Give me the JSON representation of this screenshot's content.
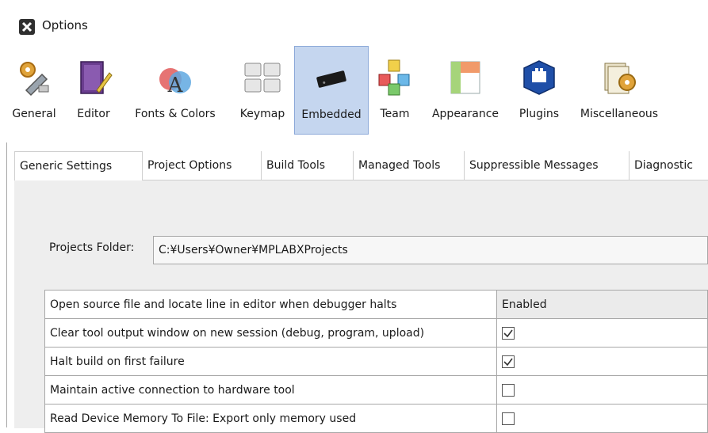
{
  "window": {
    "title": "Options"
  },
  "categories": [
    {
      "label": "General"
    },
    {
      "label": "Editor"
    },
    {
      "label": "Fonts & Colors"
    },
    {
      "label": "Keymap"
    },
    {
      "label": "Embedded",
      "selected": true
    },
    {
      "label": "Team"
    },
    {
      "label": "Appearance"
    },
    {
      "label": "Plugins"
    },
    {
      "label": "Miscellaneous"
    }
  ],
  "tabs": [
    {
      "label": "Generic Settings",
      "active": true
    },
    {
      "label": "Project Options"
    },
    {
      "label": "Build Tools"
    },
    {
      "label": "Managed Tools"
    },
    {
      "label": "Suppressible Messages"
    },
    {
      "label": "Diagnostic"
    }
  ],
  "projects_folder": {
    "label": "Projects Folder:",
    "value": "C:¥Users¥Owner¥MPLABXProjects"
  },
  "settings": [
    {
      "name": "Open source file and locate line in editor when debugger halts",
      "value": "Enabled"
    },
    {
      "name": "Clear tool output window on new session (debug, program, upload)",
      "checked": true
    },
    {
      "name": "Halt build on first failure",
      "checked": true
    },
    {
      "name": "Maintain active connection to hardware tool",
      "checked": false
    },
    {
      "name": "Read Device Memory To File: Export only memory used",
      "checked": false
    }
  ],
  "colors": {
    "selected_bg": "#c5d6ef",
    "panel_bg": "#eeeeee"
  }
}
